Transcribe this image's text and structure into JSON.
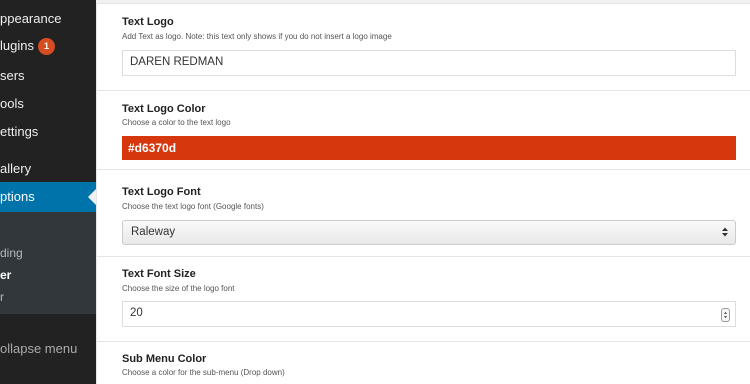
{
  "sidebar": {
    "items": [
      {
        "label": "ppearance"
      },
      {
        "label": "lugins",
        "badge": "1"
      },
      {
        "label": "sers"
      },
      {
        "label": "ools"
      },
      {
        "label": "ettings"
      },
      {
        "label": "allery"
      },
      {
        "label": "ptions"
      }
    ],
    "submenu": [
      "ding",
      "er",
      "r"
    ],
    "collapse_label": "ollapse menu"
  },
  "fields": {
    "text_logo": {
      "title": "Text Logo",
      "desc": "Add Text as logo. Note: this text only shows if you do not insert a logo image",
      "value": "DAREN REDMAN"
    },
    "text_logo_color": {
      "title": "Text Logo Color",
      "desc": "Choose a color to the text logo",
      "value": "#d6370d"
    },
    "text_logo_font": {
      "title": "Text Logo Font",
      "desc": "Choose the text logo font (Google fonts)",
      "value": "Raleway"
    },
    "text_font_size": {
      "title": "Text Font Size",
      "desc": "Choose the size of the logo font",
      "value": "20"
    },
    "sub_menu_color": {
      "title": "Sub Menu Color",
      "desc": "Choose a color for the sub-menu (Drop down)"
    }
  },
  "colors": {
    "sidebar_bg": "#222222",
    "active_bg": "#0073aa",
    "logo_color": "#d6370d",
    "badge": "#d54e21"
  }
}
